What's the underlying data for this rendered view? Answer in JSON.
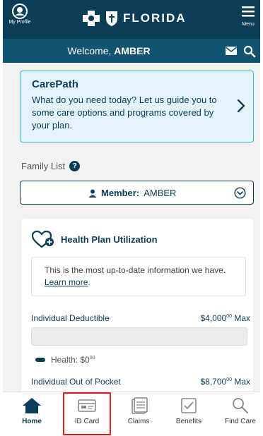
{
  "header": {
    "profile_label": "My Profile",
    "brand": "FLORIDA",
    "menu_label": "Menu",
    "welcome_prefix": "Welcome, ",
    "welcome_name": "AMBER"
  },
  "carepath": {
    "title": "CarePath",
    "description": "What do you need today? Let us guide you to some care options and programs covered by your plan."
  },
  "family": {
    "label": "Family List",
    "help_glyph": "?"
  },
  "member": {
    "prefix": "Member:",
    "name": "AMBER"
  },
  "utilization": {
    "title": "Health Plan Utilization",
    "note_text": "This is the most up-to-date information we have.",
    "learn_more": "Learn more",
    "note_suffix": ".",
    "deductible_label": "Individual Deductible",
    "deductible_amount": "$4,000",
    "deductible_cents": "00",
    "deductible_suffix": " Max",
    "legend_label": "Health: $0",
    "legend_cents": "00",
    "oop_label": "Individual Out of Pocket",
    "oop_amount": "$8,700",
    "oop_cents": "00",
    "oop_suffix": " Max"
  },
  "nav": {
    "items": [
      {
        "label": "Home"
      },
      {
        "label": "ID Card"
      },
      {
        "label": "Claims"
      },
      {
        "label": "Benefits"
      },
      {
        "label": "Find Care"
      }
    ],
    "highlight_color": "#e01e1e"
  },
  "colors": {
    "primary": "#0c3d58",
    "accent": "#35b5e2"
  }
}
